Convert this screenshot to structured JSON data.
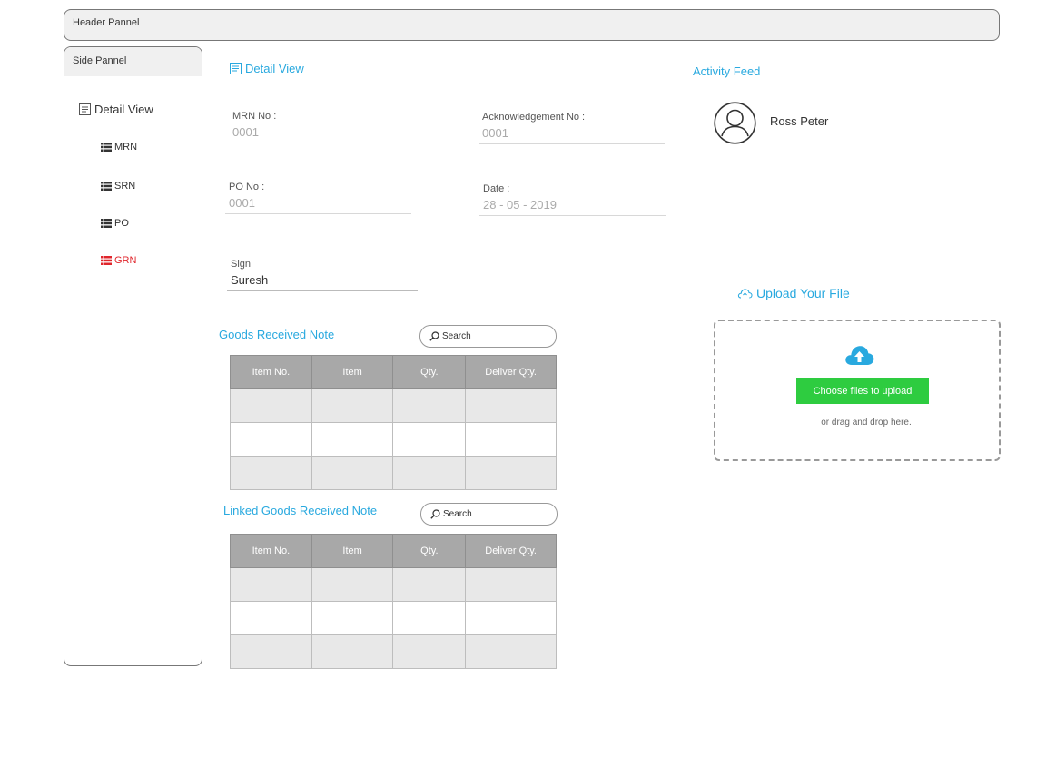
{
  "header": {
    "title": "Header Pannel"
  },
  "side": {
    "title": "Side Pannel",
    "detail_view": "Detail View",
    "items": [
      {
        "label": "MRN"
      },
      {
        "label": "SRN"
      },
      {
        "label": "PO"
      },
      {
        "label": "GRN"
      }
    ]
  },
  "detail": {
    "title": "Detail View",
    "mrn_label": "MRN No :",
    "mrn_value": "0001",
    "ack_label": "Acknowledgement No :",
    "ack_value": "0001",
    "po_label": "PO No :",
    "po_value": "0001",
    "date_label": "Date :",
    "date_value": "28 - 05 - 2019",
    "sign_label": "Sign",
    "sign_value": "Suresh"
  },
  "grn": {
    "title": "Goods Received Note",
    "search_placeholder": "Search",
    "columns": [
      "Item No.",
      "Item",
      "Qty.",
      "Deliver Qty."
    ]
  },
  "linked": {
    "title": "Linked Goods Received Note",
    "search_placeholder": "Search",
    "columns": [
      "Item No.",
      "Item",
      "Qty.",
      "Deliver Qty."
    ]
  },
  "activity": {
    "title": "Activity Feed",
    "person": "Ross Peter"
  },
  "upload": {
    "title": "Upload Your File",
    "button": "Choose files to upload",
    "hint": "or drag and drop here."
  },
  "colors": {
    "accent": "#29a9df",
    "active_nav": "#e0262c",
    "upload_button": "#2ecc40",
    "table_header": "#a8a8a8"
  }
}
